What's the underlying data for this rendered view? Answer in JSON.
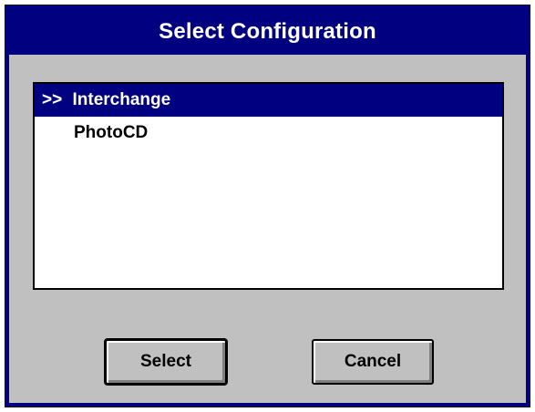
{
  "dialog": {
    "title": "Select Configuration"
  },
  "list": {
    "items": [
      {
        "marker": ">>",
        "label": "Interchange",
        "selected": true
      },
      {
        "marker": "",
        "label": "PhotoCD",
        "selected": false
      }
    ]
  },
  "buttons": {
    "select_label": "Select",
    "cancel_label": "Cancel"
  },
  "colors": {
    "title_bar": "#000080",
    "dialog_bg": "#c0c0c0",
    "selection": "#000080"
  }
}
